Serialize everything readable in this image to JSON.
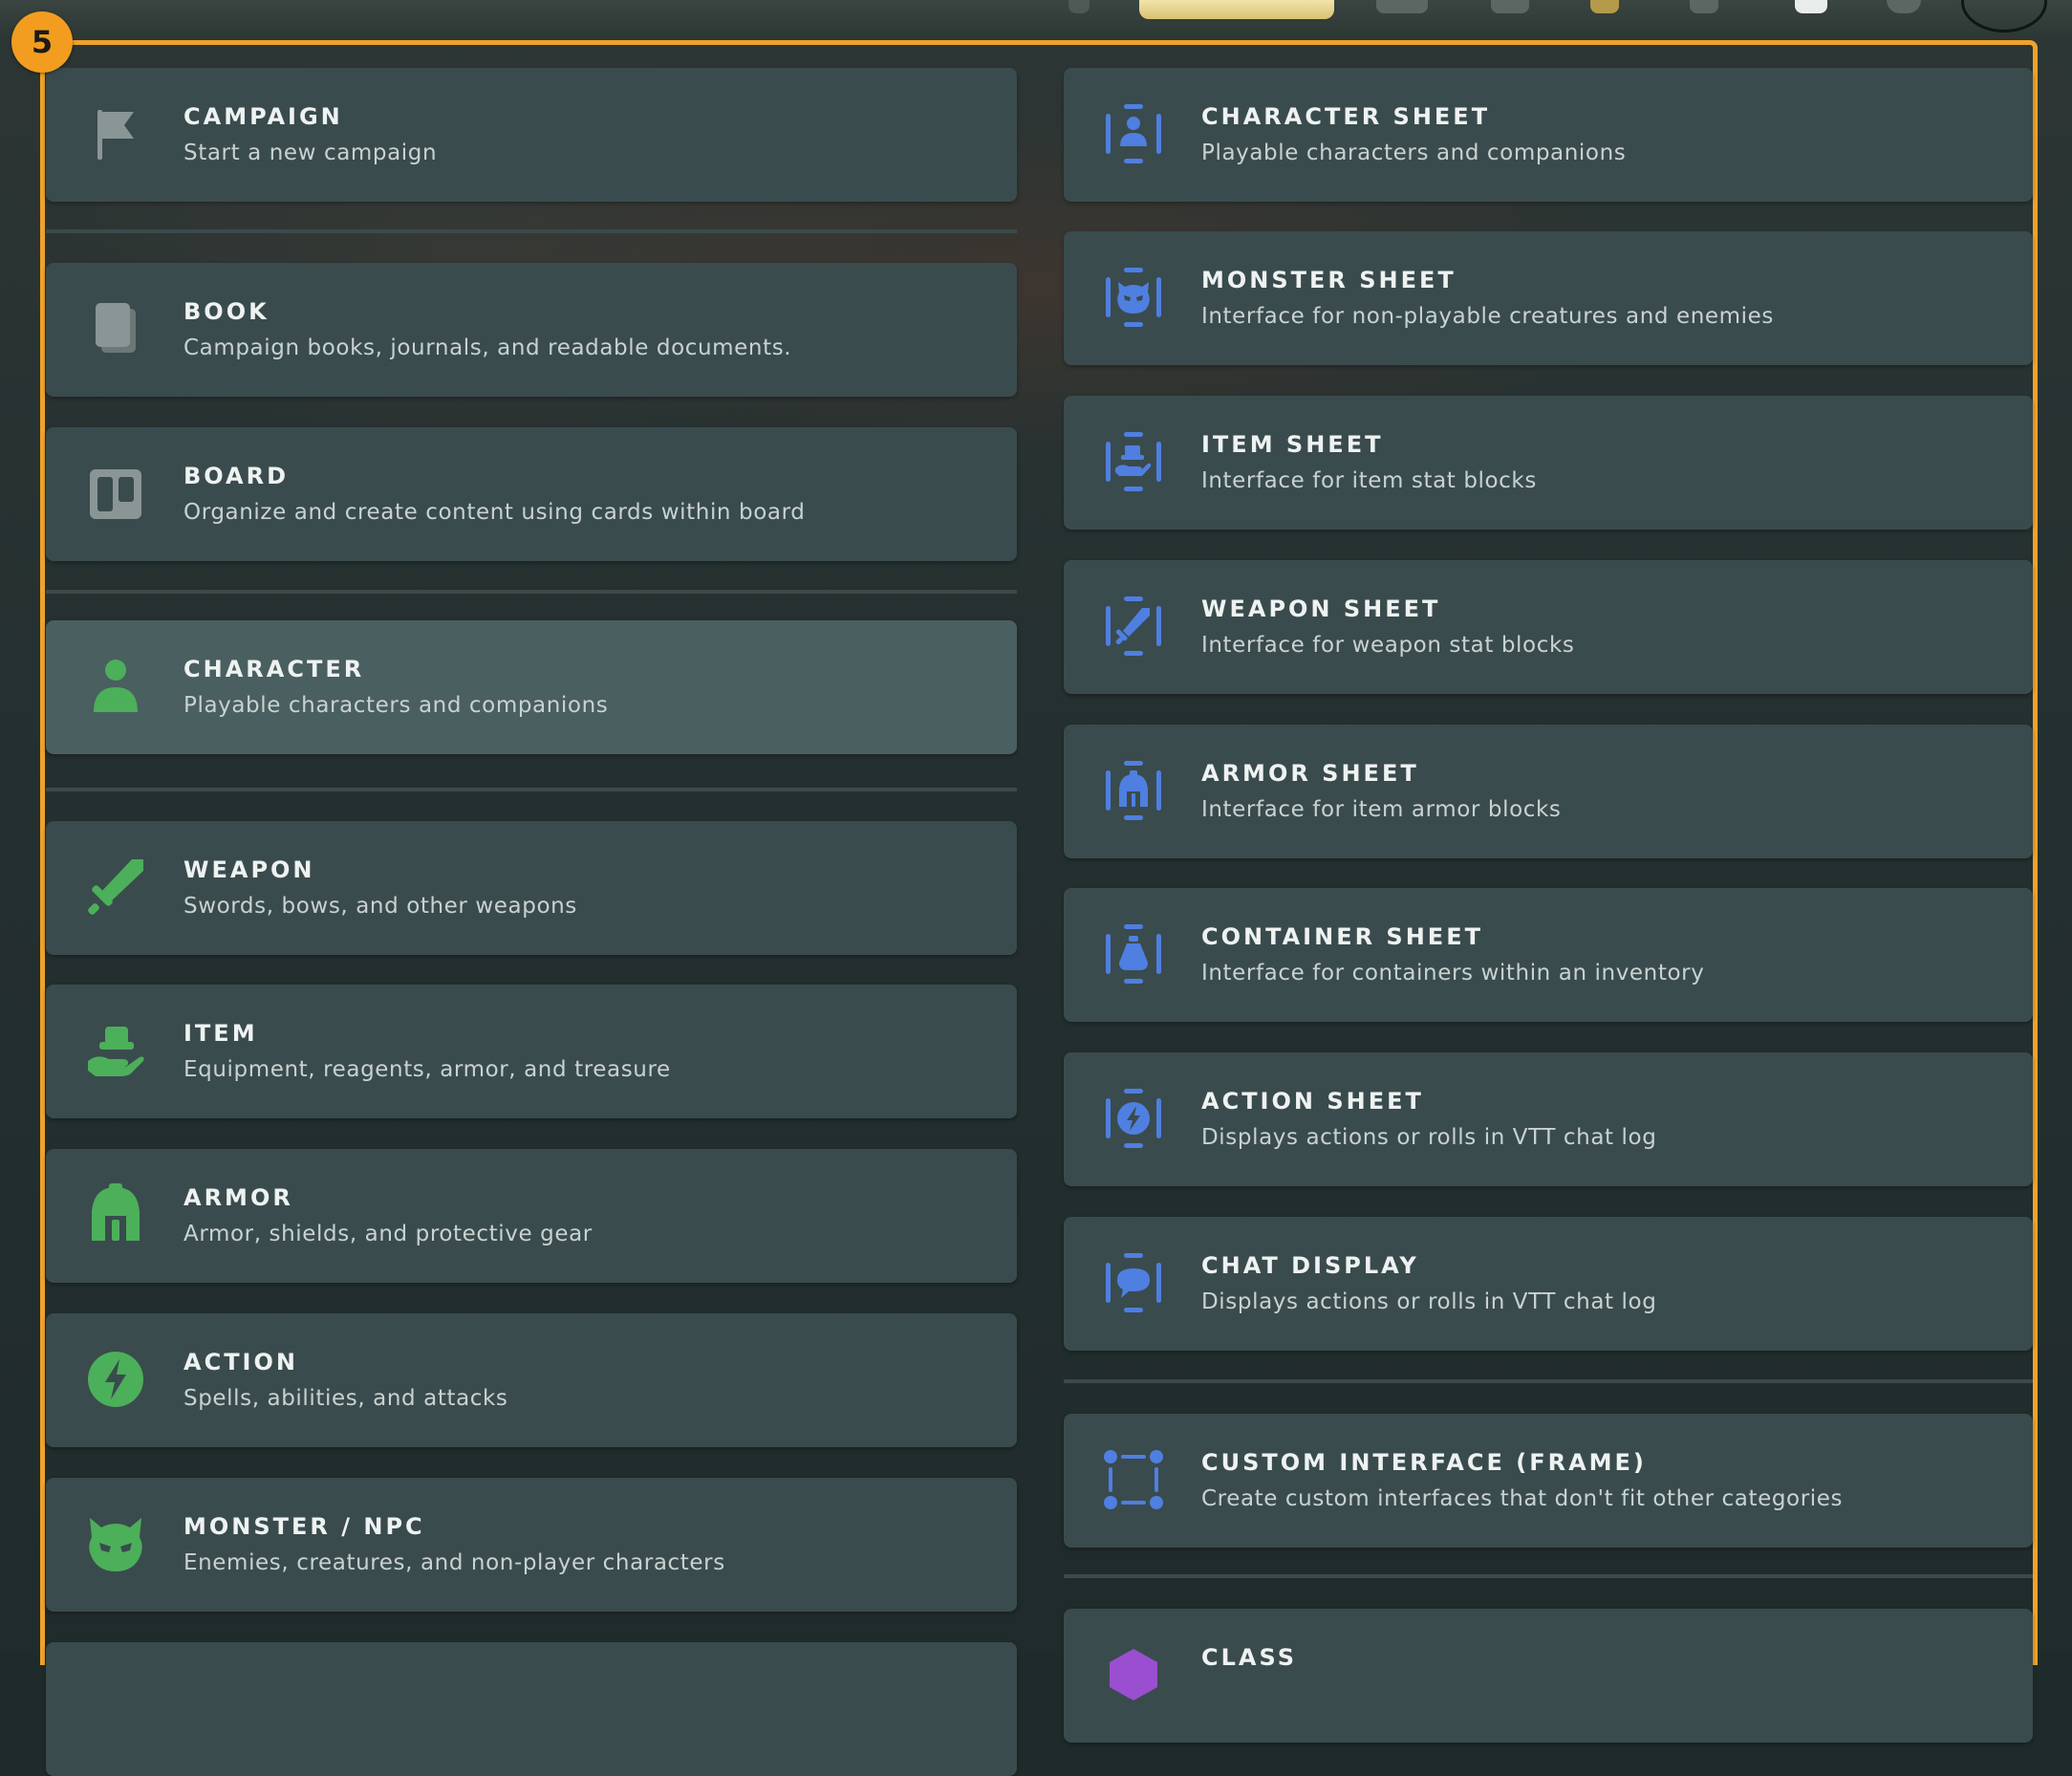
{
  "badge": {
    "number": "5"
  },
  "left_items": [
    {
      "title": "CAMPAIGN",
      "subtitle": "Start a new campaign",
      "icon": "flag-icon"
    },
    {
      "title": "BOOK",
      "subtitle": "Campaign books, journals, and readable documents.",
      "icon": "book-icon"
    },
    {
      "title": "BOARD",
      "subtitle": "Organize and create content using cards within board",
      "icon": "board-icon"
    },
    {
      "title": "CHARACTER",
      "subtitle": "Playable characters and companions",
      "icon": "person-icon",
      "selected": true
    },
    {
      "title": "WEAPON",
      "subtitle": "Swords, bows, and other weapons",
      "icon": "sword-icon"
    },
    {
      "title": "ITEM",
      "subtitle": "Equipment, reagents, armor, and treasure",
      "icon": "hand-item-icon"
    },
    {
      "title": "ARMOR",
      "subtitle": "Armor, shields, and protective gear",
      "icon": "helmet-icon"
    },
    {
      "title": "ACTION",
      "subtitle": "Spells, abilities, and attacks",
      "icon": "lightning-icon"
    },
    {
      "title": "MONSTER / NPC",
      "subtitle": "Enemies, creatures, and non-player characters",
      "icon": "monster-icon"
    }
  ],
  "right_items": [
    {
      "title": "CHARACTER SHEET",
      "subtitle": "Playable characters and companions",
      "icon": "character-sheet-icon"
    },
    {
      "title": "MONSTER SHEET",
      "subtitle": "Interface for non-playable creatures and enemies",
      "icon": "monster-sheet-icon"
    },
    {
      "title": "ITEM SHEET",
      "subtitle": "Interface for item stat blocks",
      "icon": "item-sheet-icon"
    },
    {
      "title": "WEAPON SHEET",
      "subtitle": "Interface for weapon stat blocks",
      "icon": "weapon-sheet-icon"
    },
    {
      "title": "ARMOR SHEET",
      "subtitle": "Interface for item armor blocks",
      "icon": "armor-sheet-icon"
    },
    {
      "title": "CONTAINER SHEET",
      "subtitle": "Interface for containers within an inventory",
      "icon": "container-sheet-icon"
    },
    {
      "title": "ACTION SHEET",
      "subtitle": "Displays actions or rolls in VTT chat log",
      "icon": "action-sheet-icon"
    },
    {
      "title": "CHAT DISPLAY",
      "subtitle": "Displays actions or rolls in VTT chat log",
      "icon": "chat-display-icon"
    },
    {
      "title": "CUSTOM INTERFACE (FRAME)",
      "subtitle": "Create custom interfaces that don't fit other categories",
      "icon": "frame-icon"
    },
    {
      "title": "CLASS",
      "subtitle": "",
      "icon": "class-icon"
    }
  ],
  "colors": {
    "accent_orange": "#f0a22a",
    "icon_green": "#4caf5a",
    "icon_blue": "#4f7fe0",
    "icon_gray": "#8a9695",
    "icon_purple": "#9a4fd0",
    "card_bg": "#3a4b4d",
    "card_selected_bg": "#4a5f60"
  }
}
